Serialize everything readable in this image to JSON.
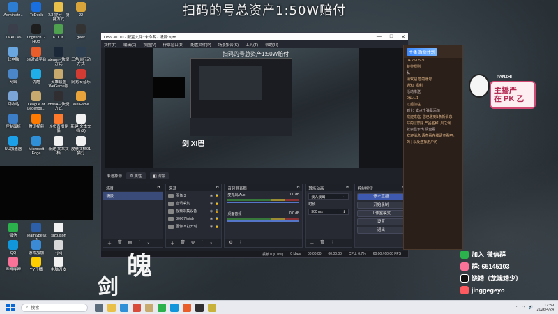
{
  "overlay_title": "扫码的号总资产1:50W赔付",
  "desktop_icons": [
    {
      "label": "Administr...",
      "color": "#2d7dd2"
    },
    {
      "label": "ToDesk",
      "color": "#1a6fe0"
    },
    {
      "label": "7.3 提分 - 快捷方式",
      "color": "#e8c04a"
    },
    {
      "label": "22",
      "color": "#d9a53a"
    },
    {
      "label": "TMAC v6",
      "color": "#3a3f4b"
    },
    {
      "label": "Logitech G HUB",
      "color": "#1e1e1e"
    },
    {
      "label": "KOOK",
      "color": "#4fa14f"
    },
    {
      "label": "geek",
      "color": "#333"
    },
    {
      "label": "此电脑",
      "color": "#6aa7e0"
    },
    {
      "label": "5E对战平台",
      "color": "#e85d2a"
    },
    {
      "label": "steam - 快捷方式",
      "color": "#1b2838"
    },
    {
      "label": "三角洲行动方式",
      "color": "#2c3e50"
    },
    {
      "label": "网络",
      "color": "#4a86c8"
    },
    {
      "label": "优酷",
      "color": "#1faee8"
    },
    {
      "label": "英雄联盟 WeGame版",
      "color": "#c8aa6e"
    },
    {
      "label": "网易云音乐",
      "color": "#d43c33"
    },
    {
      "label": "回收站",
      "color": "#7aa5d6"
    },
    {
      "label": "League of Legends...",
      "color": "#c8aa6e"
    },
    {
      "label": "obs64 - 快捷方式",
      "color": "#302e31"
    },
    {
      "label": "WeGame",
      "color": "#e8a33a"
    },
    {
      "label": "控制面板",
      "color": "#3c7ec8"
    },
    {
      "label": "腾讯视频",
      "color": "#ff7a00"
    },
    {
      "label": "斗鱼直播伴侣",
      "color": "#ff7a2a"
    },
    {
      "label": "新建 文本文档 (2)",
      "color": "#f1f1f1"
    },
    {
      "label": "UU加速器",
      "color": "#1ca0e8"
    },
    {
      "label": "Microsoft Edge",
      "color": "#2f8fd7"
    },
    {
      "label": "新建 文本文档",
      "color": "#f1f1f1"
    },
    {
      "label": "皮肤文档01猫灯",
      "color": "#f1f1f1"
    },
    {
      "label": "微信",
      "color": "#2bb24c"
    },
    {
      "label": "TeamSpeak 3",
      "color": "#2c5fa8"
    },
    {
      "label": "sjzb.json",
      "color": "#f1f1f1"
    },
    {
      "label": "QQ",
      "color": "#1296db"
    },
    {
      "label": "游戏加加",
      "color": "#3a8ad6"
    },
    {
      "label": "~jhlj",
      "color": "#d8d8d8"
    },
    {
      "label": "哔哩哔哩",
      "color": "#fb7299"
    },
    {
      "label": "YY开播",
      "color": "#ffce00"
    },
    {
      "label": "电脑刀皮",
      "color": "#f1f1f1"
    }
  ],
  "obs": {
    "title": "OBS 30.0.0 - 配置文件: 未命名 - 场景: sjzb",
    "menu": [
      "文件(F)",
      "编辑(E)",
      "视图(V)",
      "停靠窗口(D)",
      "配置文件(P)",
      "场景集合(S)",
      "工具(T)",
      "帮助(H)"
    ],
    "preview_title": "扫码的号总资产1:50W赔付",
    "preview_logo": "剑 XI巴",
    "no_source": "未选择源",
    "props_btn": "属性",
    "filters_btn": "滤镜",
    "scenes": {
      "header": "场景",
      "items": [
        "场景"
      ]
    },
    "sources": {
      "header": "来源",
      "items": [
        "图像 3",
        "音讯采集",
        "视频采集设备",
        "3000万ntsb",
        "图像 8 打开时"
      ]
    },
    "mixer": {
      "header": "音频混音器",
      "channels": [
        {
          "name": "麦克风/Aux",
          "db": "1.0 dB"
        },
        {
          "name": "桌面音频",
          "db": "0.0 dB"
        }
      ]
    },
    "transitions": {
      "header": "转场动画",
      "type": "淡入淡出",
      "duration_label": "时长",
      "duration": "300 ms"
    },
    "controls": {
      "header": "控制按钮",
      "buttons": [
        "停止直播",
        "开始录制",
        "工作室模式",
        "设置",
        "退出"
      ]
    },
    "status": {
      "dropped": "丢帧 0 (0.0%)",
      "kbps": "0 kbps",
      "stream_time": "00:00:00",
      "rec_time": "00:00:00",
      "cpu": "CPU: 0.7%",
      "fps": "60.00 / 60.00 FPS"
    }
  },
  "browser": {
    "banner": "主播 激励计划",
    "lines": [
      "04.25-05.30",
      "获奖规则",
      "私",
      "消欢迎 您的账号..",
      "通知: 福利",
      "活动推送",
      "0私人/1",
      "以后前往",
      "到化: 或点击弹幕添加",
      "欢迎来临: 您已收到1条新消息",
      "好的 | 您好 产品名称: 风之佩",
      "就会显示出 请查看",
      "欢迎消息 请查看在线请查看吧。",
      "的 | 以及选择用户的"
    ]
  },
  "panzhi": {
    "name": "PANZHI",
    "line1": "主播严",
    "line2": "在 PK 乙"
  },
  "info": [
    {
      "text": "加入",
      "emoji": "微信群",
      "color": "#2bb24c"
    },
    {
      "text": "群: 65145103",
      "color": "#fb7299"
    },
    {
      "text": "饶靖（龙魄靖少）",
      "color": "#111"
    },
    {
      "text": "jinggegeyo",
      "color": "#ff5a5f"
    }
  ],
  "big_chars": [
    "魄",
    "剑"
  ],
  "taskbar": {
    "search_placeholder": "搜索",
    "time": "17:39",
    "date": "2026/4/24"
  }
}
